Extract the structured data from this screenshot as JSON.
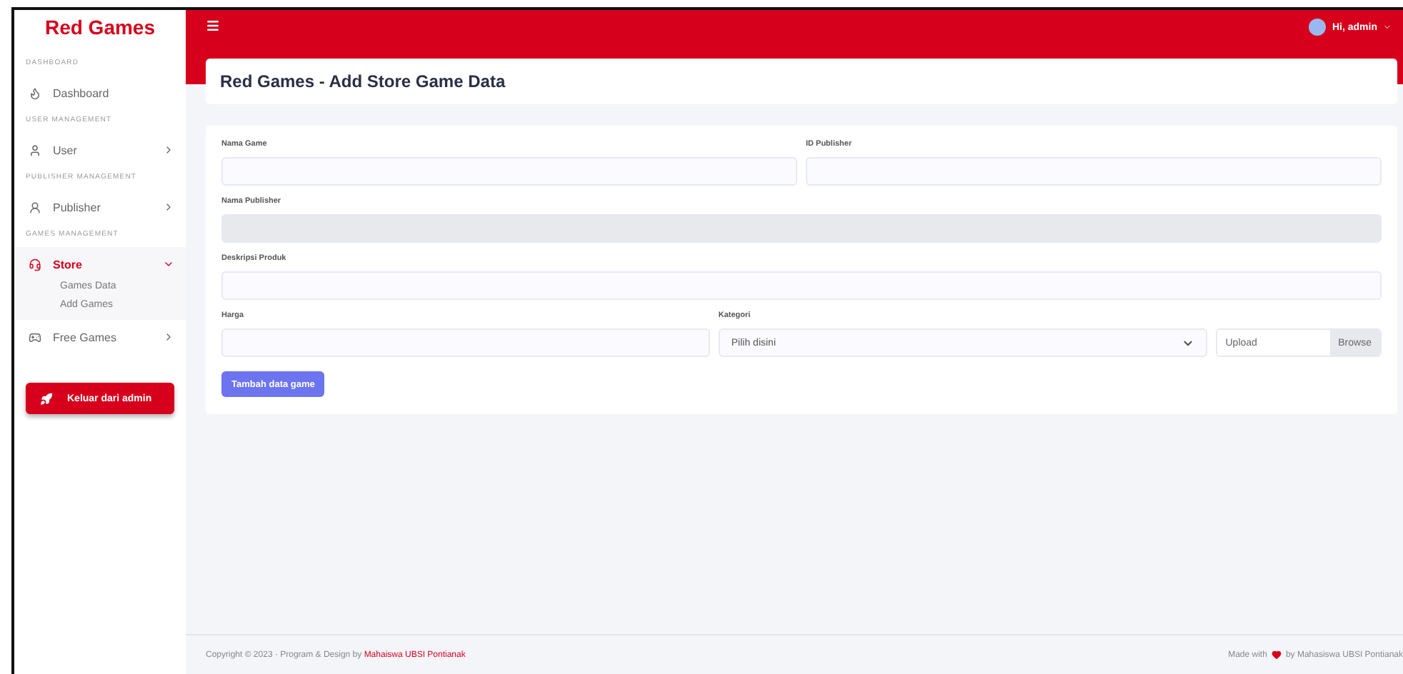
{
  "sidebar": {
    "brand": "Red Games",
    "sections": [
      {
        "heading": "DASHBOARD",
        "items": [
          {
            "label": "Dashboard",
            "selected": false
          }
        ]
      },
      {
        "heading": "USER MANAGEMENT",
        "items": [
          {
            "label": "User",
            "selected": false,
            "expanded": false
          }
        ]
      },
      {
        "heading": "PUBLISHER MANAGEMENT",
        "items": [
          {
            "label": "Publisher",
            "selected": false,
            "expanded": false
          }
        ]
      },
      {
        "heading": "GAMES MANAGEMENT",
        "items": [
          {
            "label": "Store",
            "selected": true,
            "expanded": true,
            "children": [
              {
                "label": "Games Data"
              },
              {
                "label": "Add Games"
              }
            ]
          },
          {
            "label": "Free Games",
            "selected": false,
            "expanded": false
          }
        ]
      }
    ],
    "logout_button": "Keluar dari admin"
  },
  "topbar": {
    "user": "Hi, admin"
  },
  "page_title": "Red Games - Add Store Game Data",
  "form": {
    "rows": [
      [
        {
          "kind": "text",
          "label": "Nama Game"
        },
        {
          "kind": "text",
          "label": "ID Publisher"
        }
      ],
      [
        {
          "kind": "disabled",
          "label": "Nama Publisher"
        }
      ],
      [
        {
          "kind": "text",
          "label": "Deskripsi Produk"
        }
      ],
      [
        {
          "kind": "text",
          "label": "Harga"
        },
        {
          "kind": "select",
          "label": "Kategori",
          "value": "Pilih disini"
        },
        {
          "kind": "file",
          "placeholder": "Upload",
          "button": "Browse"
        }
      ]
    ],
    "submit": "Tambah data game"
  },
  "footer": {
    "left": "Copyright © 2023  ·  Program & Design by",
    "link": "Mahaiswa UBSI Pontianak",
    "right_before": "Made with",
    "right_after": "by Mahasiswa UBSI Pontianak"
  }
}
